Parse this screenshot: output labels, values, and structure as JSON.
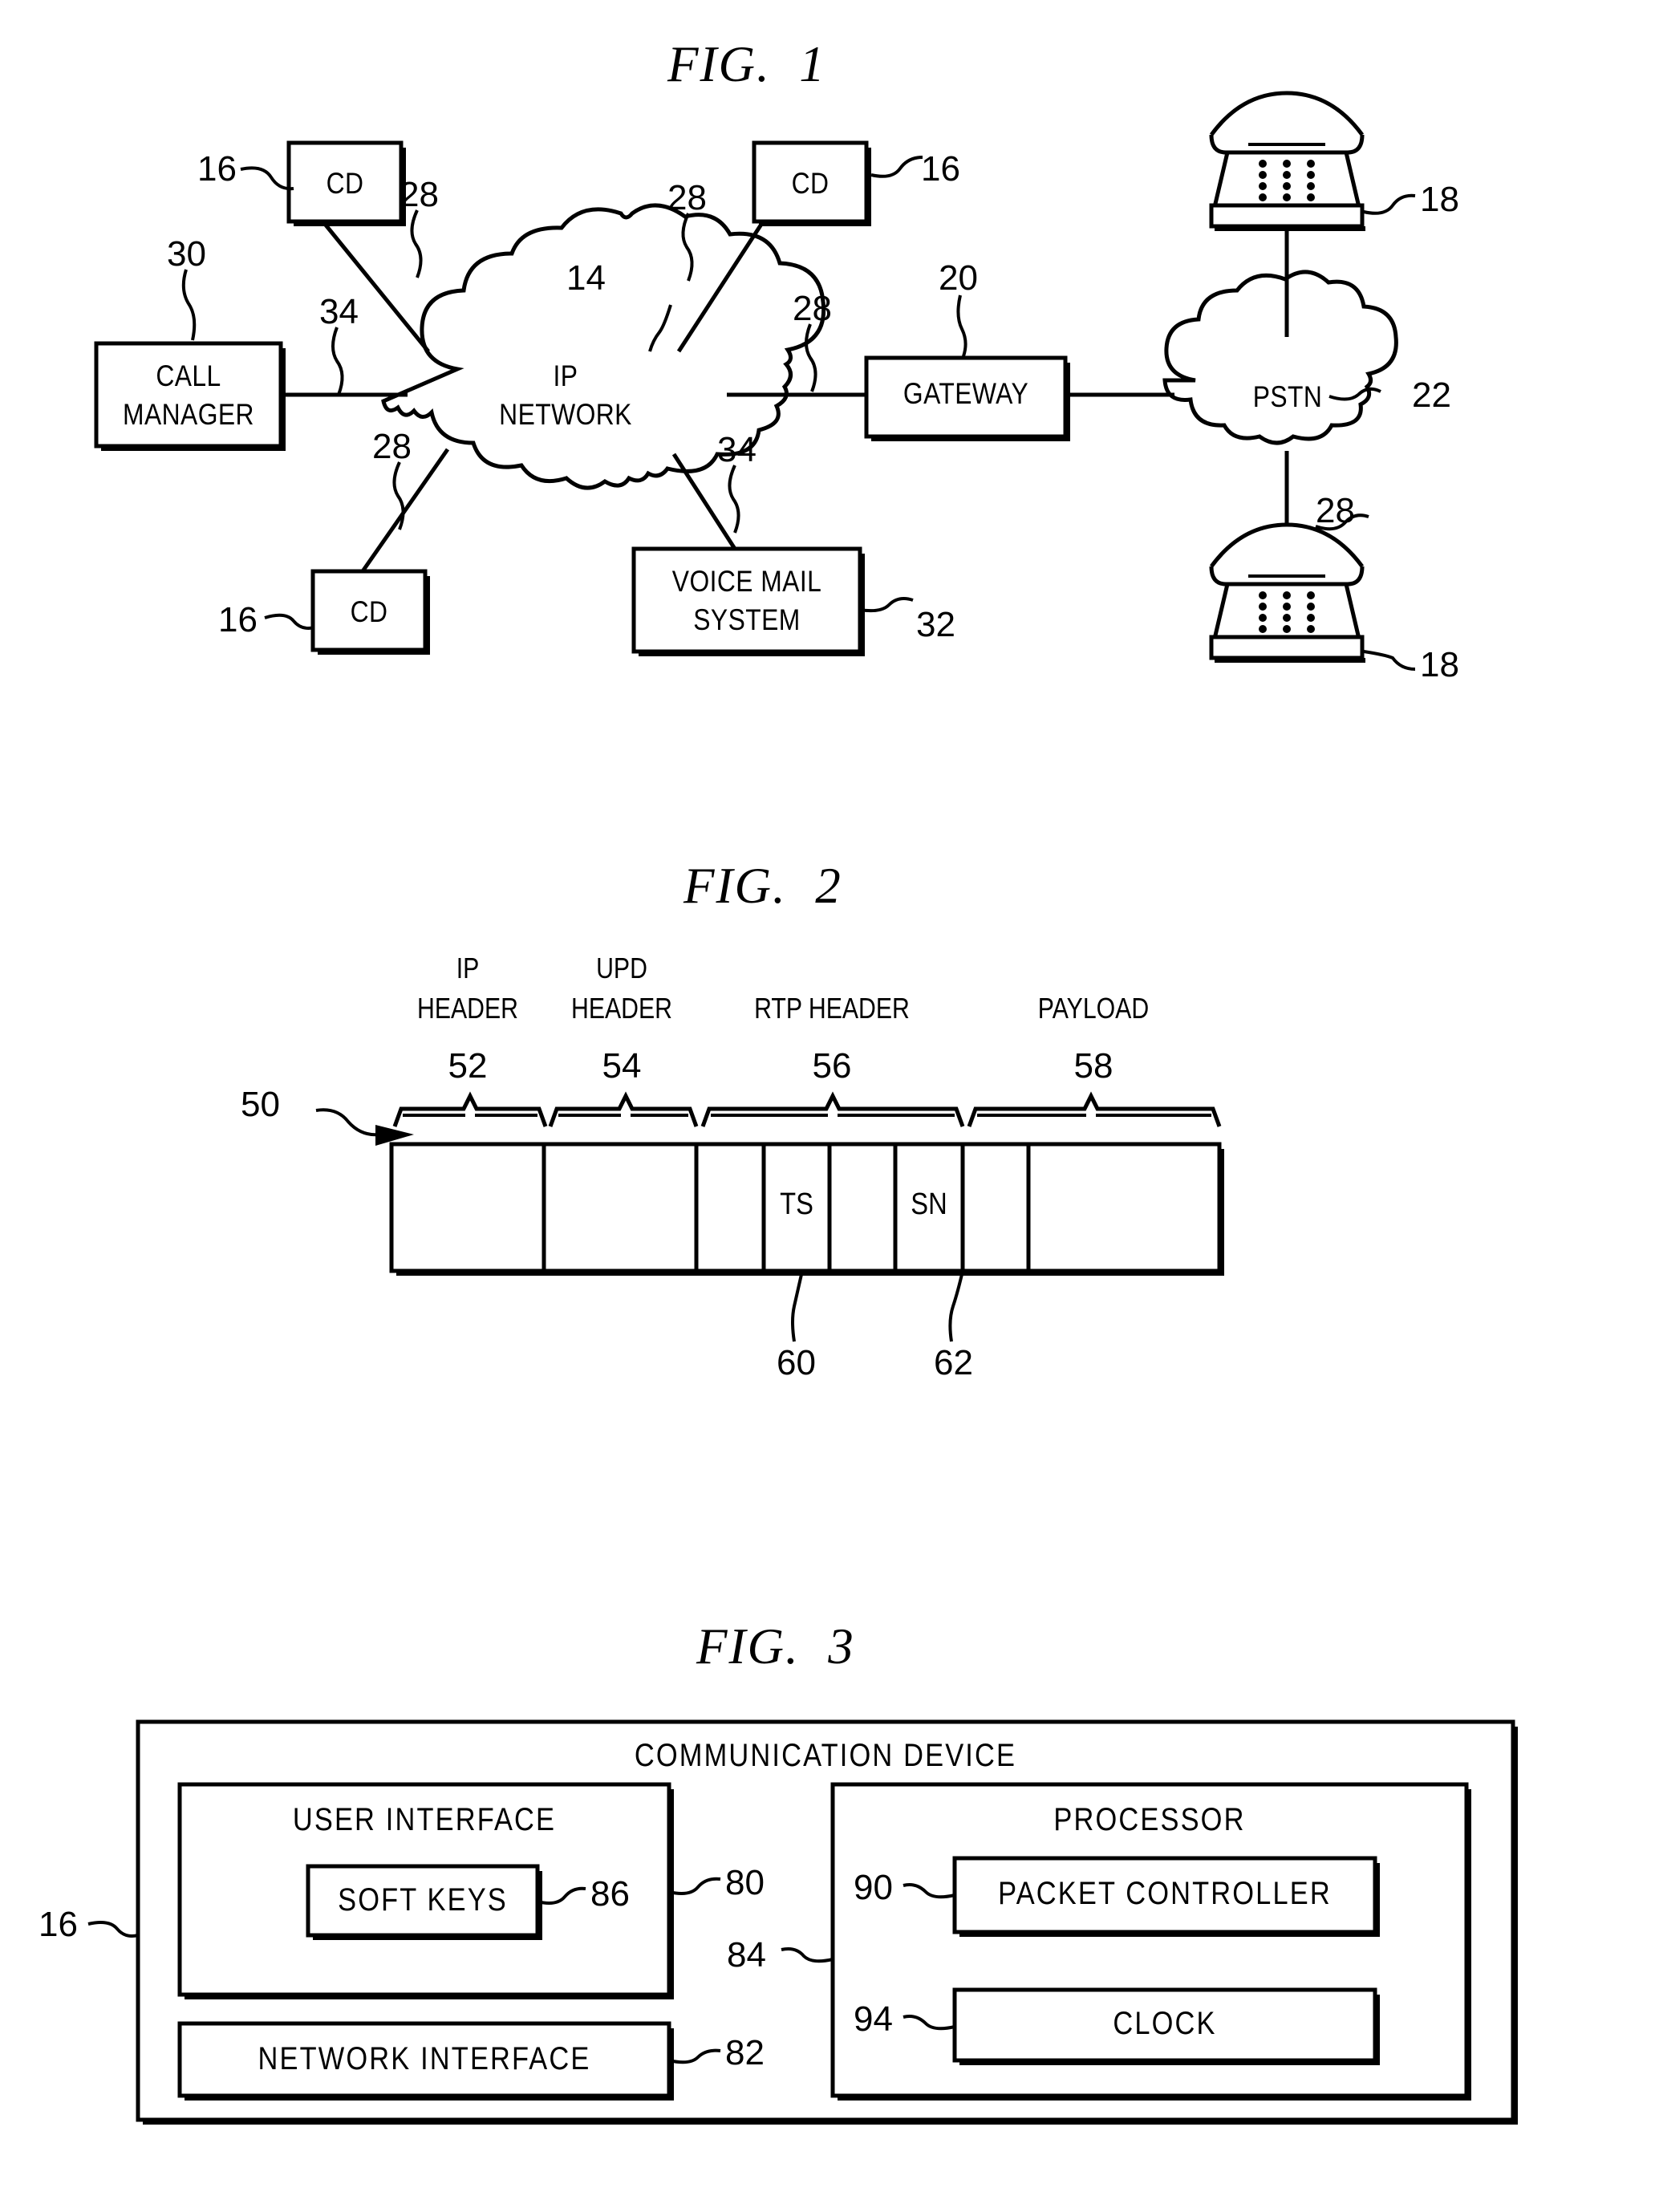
{
  "figures": [
    {
      "id": "fig1",
      "title": "FIG.  1",
      "nodes": {
        "cd_top_left": "CD",
        "cd_top_right": "CD",
        "cd_bottom_left": "CD",
        "call_manager_line1": "CALL",
        "call_manager_line2": "MANAGER",
        "ip_network_line1": "IP",
        "ip_network_line2": "NETWORK",
        "gateway": "GATEWAY",
        "pstn": "PSTN",
        "voice_mail_line1": "VOICE MAIL",
        "voice_mail_line2": "SYSTEM"
      },
      "refs": {
        "cd_top_left": "16",
        "cd_top_right": "16",
        "cd_bottom_left": "16",
        "call_manager": "30",
        "ip_network": "14",
        "gateway": "20",
        "pstn": "22",
        "voice_mail": "32",
        "phone_top": "18",
        "phone_bottom": "18",
        "link_cd_tl": "28",
        "link_cd_tr": "28",
        "link_gateway": "28",
        "link_cd_bl": "28",
        "link_pstn_phone": "28",
        "link_call_manager": "34",
        "link_voice_mail": "34"
      }
    },
    {
      "id": "fig2",
      "title": "FIG.  2",
      "packet_ref": "50",
      "segments": [
        {
          "label_line1": "IP",
          "label_line2": "HEADER",
          "ref": "52"
        },
        {
          "label_line1": "UPD",
          "label_line2": "HEADER",
          "ref": "54"
        },
        {
          "label_line1": "",
          "label_line2": "RTP HEADER",
          "ref": "56"
        },
        {
          "label_line1": "",
          "label_line2": "PAYLOAD",
          "ref": "58"
        }
      ],
      "cells": {
        "timestamp": "TS",
        "sequence_number": "SN"
      },
      "cell_refs": {
        "timestamp": "60",
        "sequence_number": "62"
      }
    },
    {
      "id": "fig3",
      "title": "FIG.  3",
      "device_title": "COMMUNICATION DEVICE",
      "blocks": {
        "user_interface": "USER INTERFACE",
        "soft_keys": "SOFT KEYS",
        "network_interface": "NETWORK INTERFACE",
        "processor": "PROCESSOR",
        "packet_controller": "PACKET CONTROLLER",
        "clock": "CLOCK"
      },
      "refs": {
        "device": "16",
        "user_interface": "80",
        "network_interface": "82",
        "processor": "84",
        "soft_keys": "86",
        "packet_controller": "90",
        "clock": "94"
      }
    }
  ],
  "colors": {
    "ink": "#000000",
    "paper": "#ffffff"
  }
}
